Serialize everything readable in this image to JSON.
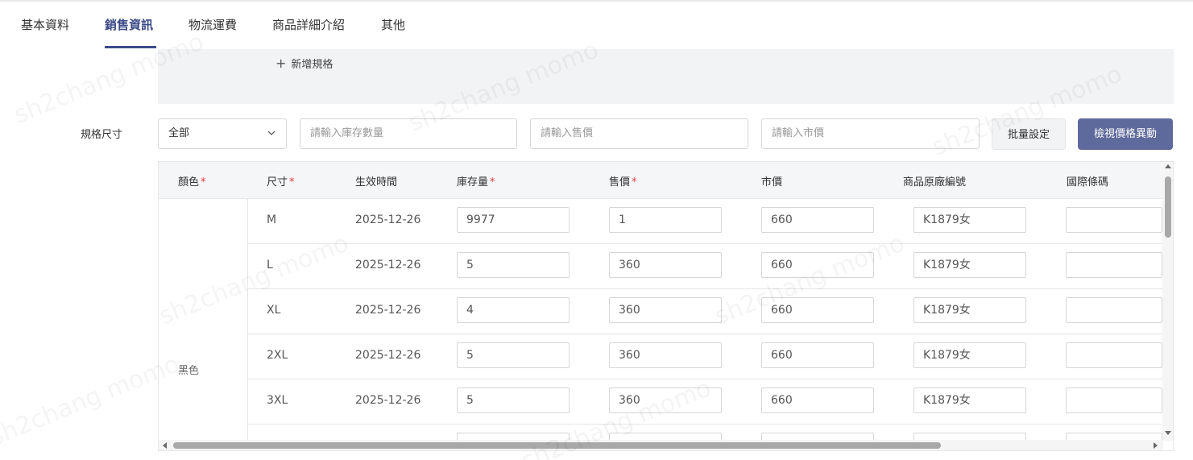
{
  "tabs": [
    {
      "label": "基本資料",
      "active": false
    },
    {
      "label": "銷售資訊",
      "active": true
    },
    {
      "label": "物流運費",
      "active": false
    },
    {
      "label": "商品詳細介紹",
      "active": false
    },
    {
      "label": "其他",
      "active": false
    }
  ],
  "spec": {
    "add_spec_label": "新增規格",
    "section_label": "規格尺寸",
    "filter_select_value": "全部",
    "stock_placeholder": "請輸入庫存數量",
    "price_placeholder": "請輸入售價",
    "market_price_placeholder": "請輸入市價",
    "batch_button": "批量設定",
    "view_price_button": "檢視價格異動"
  },
  "table": {
    "headers": {
      "color": "顏色",
      "size": "尺寸",
      "effective_time": "生效時間",
      "stock": "庫存量",
      "price": "售價",
      "market_price": "市價",
      "vendor_code": "商品原廠編號",
      "barcode": "國際條碼"
    },
    "required_mark": "*",
    "color_group": "黑色",
    "rows": [
      {
        "size": "M",
        "date": "2025-12-26",
        "stock": "9977",
        "price": "1",
        "market": "660",
        "code": "K1879女",
        "barcode": ""
      },
      {
        "size": "L",
        "date": "2025-12-26",
        "stock": "5",
        "price": "360",
        "market": "660",
        "code": "K1879女",
        "barcode": ""
      },
      {
        "size": "XL",
        "date": "2025-12-26",
        "stock": "4",
        "price": "360",
        "market": "660",
        "code": "K1879女",
        "barcode": ""
      },
      {
        "size": "2XL",
        "date": "2025-12-26",
        "stock": "5",
        "price": "360",
        "market": "660",
        "code": "K1879女",
        "barcode": ""
      },
      {
        "size": "3XL",
        "date": "2025-12-26",
        "stock": "5",
        "price": "360",
        "market": "660",
        "code": "K1879女",
        "barcode": ""
      }
    ]
  },
  "watermark": "sh2chang momo",
  "colors": {
    "accent": "#3c4a87",
    "primary_button": "#5f6a9c",
    "required": "#e4393c"
  }
}
